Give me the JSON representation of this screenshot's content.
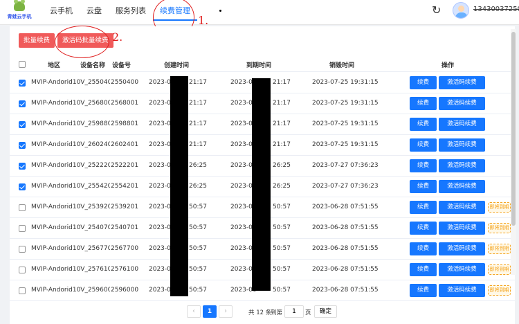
{
  "app": {
    "logo_text": "青蛙云手机"
  },
  "nav": {
    "items": [
      {
        "label": "云手机"
      },
      {
        "label": "云盘"
      },
      {
        "label": "服务列表"
      },
      {
        "label": "续费管理"
      }
    ],
    "active_index": 3
  },
  "user": {
    "name": "13430037250"
  },
  "toolbar": {
    "batch_renew": "批量续费",
    "code_batch_renew": "激活码批量续费"
  },
  "annotations": {
    "one": "1.",
    "two": "2."
  },
  "table": {
    "headers": {
      "region": "地区",
      "device_name": "设备名称",
      "device_no": "设备号",
      "created": "创建时间",
      "expires": "到期时间",
      "destroy": "销毁时间",
      "ops": "操作"
    },
    "rows": [
      {
        "checked": true,
        "name": "MVIP-Andorid10V_2550400",
        "no": "2550400",
        "created_pre": "2023-06",
        "created_post": "21:17",
        "expires_pre": "2023-07",
        "expires_post": "21:17",
        "destroy": "2023-07-25 19:31:15",
        "badge": ""
      },
      {
        "checked": true,
        "name": "MVIP-Andorid10V_2568001",
        "no": "2568001",
        "created_pre": "2023-06",
        "created_post": "21:17",
        "expires_pre": "2023-07",
        "expires_post": "21:17",
        "destroy": "2023-07-25 19:31:15",
        "badge": ""
      },
      {
        "checked": true,
        "name": "MVIP-Andorid10V_2598801",
        "no": "2598801",
        "created_pre": "2023-06",
        "created_post": "21:17",
        "expires_pre": "2023-07",
        "expires_post": "21:17",
        "destroy": "2023-07-25 19:31:15",
        "badge": ""
      },
      {
        "checked": true,
        "name": "MVIP-Andorid10V_2602401",
        "no": "2602401",
        "created_pre": "2023-06",
        "created_post": "21:17",
        "expires_pre": "2023-07",
        "expires_post": "21:17",
        "destroy": "2023-07-25 19:31:15",
        "badge": ""
      },
      {
        "checked": true,
        "name": "MVIP-Andorid10V_2522201",
        "no": "2522201",
        "created_pre": "2023-06",
        "created_post": "26:25",
        "expires_pre": "2023-07",
        "expires_post": "26:25",
        "destroy": "2023-07-27 07:36:23",
        "badge": ""
      },
      {
        "checked": true,
        "name": "MVIP-Andorid10V_2554201",
        "no": "2554201",
        "created_pre": "2023-06",
        "created_post": "26:25",
        "expires_pre": "2023-07",
        "expires_post": "26:25",
        "destroy": "2023-07-27 07:36:23",
        "badge": ""
      },
      {
        "checked": false,
        "name": "MVIP-Andorid10V_2539201",
        "no": "2539201",
        "created_pre": "2023-06",
        "created_post": "50:57",
        "expires_pre": "2023-06",
        "expires_post": "50:57",
        "destroy": "2023-06-28 07:51:55",
        "badge": "即将到期"
      },
      {
        "checked": false,
        "name": "MVIP-Andorid10V_2540701",
        "no": "2540701",
        "created_pre": "2023-06",
        "created_post": "50:57",
        "expires_pre": "2023-06",
        "expires_post": "50:57",
        "destroy": "2023-06-28 07:51:55",
        "badge": "即将到期"
      },
      {
        "checked": false,
        "name": "MVIP-Andorid10V_2567700",
        "no": "2567700",
        "created_pre": "2023-06",
        "created_post": "50:57",
        "expires_pre": "2023-06",
        "expires_post": "50:57",
        "destroy": "2023-06-28 07:51:55",
        "badge": "即将到期"
      },
      {
        "checked": false,
        "name": "MVIP-Andorid10V_2576100",
        "no": "2576100",
        "created_pre": "2023-06",
        "created_post": "50:57",
        "expires_pre": "2023-06",
        "expires_post": "50:57",
        "destroy": "2023-06-28 07:51:55",
        "badge": "即将到期"
      },
      {
        "checked": false,
        "name": "MVIP-Andorid10V_2596000",
        "no": "2596000",
        "created_pre": "2023-06",
        "created_post": "50:57",
        "expires_pre": "2023-06",
        "expires_post": "50:57",
        "destroy": "2023-06-28 07:51:55",
        "badge": "即将到期"
      }
    ],
    "renew_label": "续费",
    "code_renew_label": "激活码续费"
  },
  "pagination": {
    "current_page": "1",
    "total_text": "共 12 条",
    "goto_label": "到第",
    "goto_value": "1",
    "page_suffix": "页",
    "confirm": "确定"
  },
  "colors": {
    "primary": "#1677ff",
    "danger": "#f05a5a",
    "annotation": "#e02020",
    "warning": "#f5a623"
  }
}
